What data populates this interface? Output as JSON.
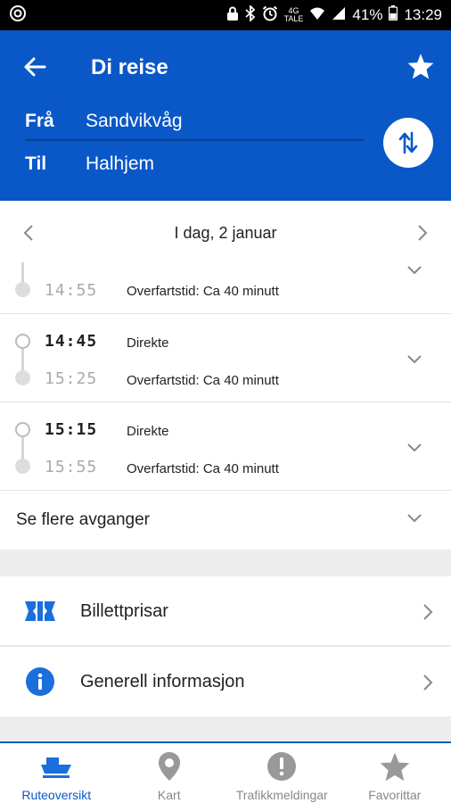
{
  "status_bar": {
    "network_label_top": "4G",
    "network_label_bottom": "TALE",
    "battery": "41%",
    "time": "13:29"
  },
  "header": {
    "title": "Di reise",
    "from_label": "Frå",
    "from_value": "Sandvikvåg",
    "to_label": "Til",
    "to_value": "Halhjem",
    "accent_color": "#0a58c8"
  },
  "date_nav": {
    "label": "I dag, 2 januar"
  },
  "departures": [
    {
      "arrival": "14:55",
      "crossing_time": "Overfartstid: Ca 40 minutt"
    },
    {
      "departure": "14:45",
      "type": "Direkte",
      "arrival": "15:25",
      "crossing_time": "Overfartstid: Ca 40 minutt"
    },
    {
      "departure": "15:15",
      "type": "Direkte",
      "arrival": "15:55",
      "crossing_time": "Overfartstid: Ca 40 minutt"
    }
  ],
  "more_departures": "Se flere avganger",
  "links": {
    "ticket_prices": "Billettprisar",
    "general_info": "Generell informasjon"
  },
  "tabs": [
    {
      "label": "Ruteoversikt",
      "icon": "ferry-icon",
      "active": true
    },
    {
      "label": "Kart",
      "icon": "map-pin-icon",
      "active": false
    },
    {
      "label": "Trafikkmeldingar",
      "icon": "alert-icon",
      "active": false
    },
    {
      "label": "Favorittar",
      "icon": "star-icon",
      "active": false
    }
  ]
}
